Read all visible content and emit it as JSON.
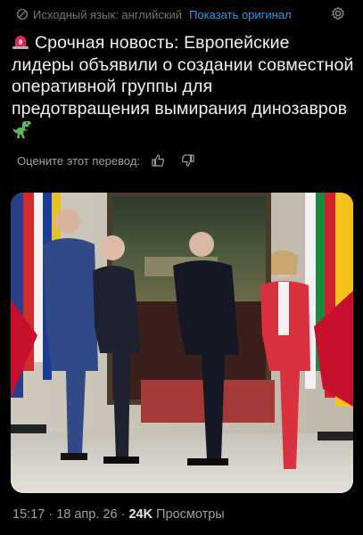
{
  "translation_bar": {
    "source_language": "Исходный язык: английский",
    "show_original": "Показать оригинал"
  },
  "tweet": {
    "text": "Срочная новость: Европейские лидеры объявили о создании совместной оперативной группы для предотвращения вымирания динозавров",
    "emoji_start": "siren-emoji",
    "emoji_end": "t-rex-emoji"
  },
  "rate": {
    "label": "Оцените этот перевод:"
  },
  "meta": {
    "time": "15:17",
    "date": "18 апр. 26",
    "views_count": "24K",
    "views_label": "Просмотры",
    "separator": "·"
  },
  "colors": {
    "background": "#000000",
    "link": "#1d9bf0",
    "muted": "#71767b"
  }
}
